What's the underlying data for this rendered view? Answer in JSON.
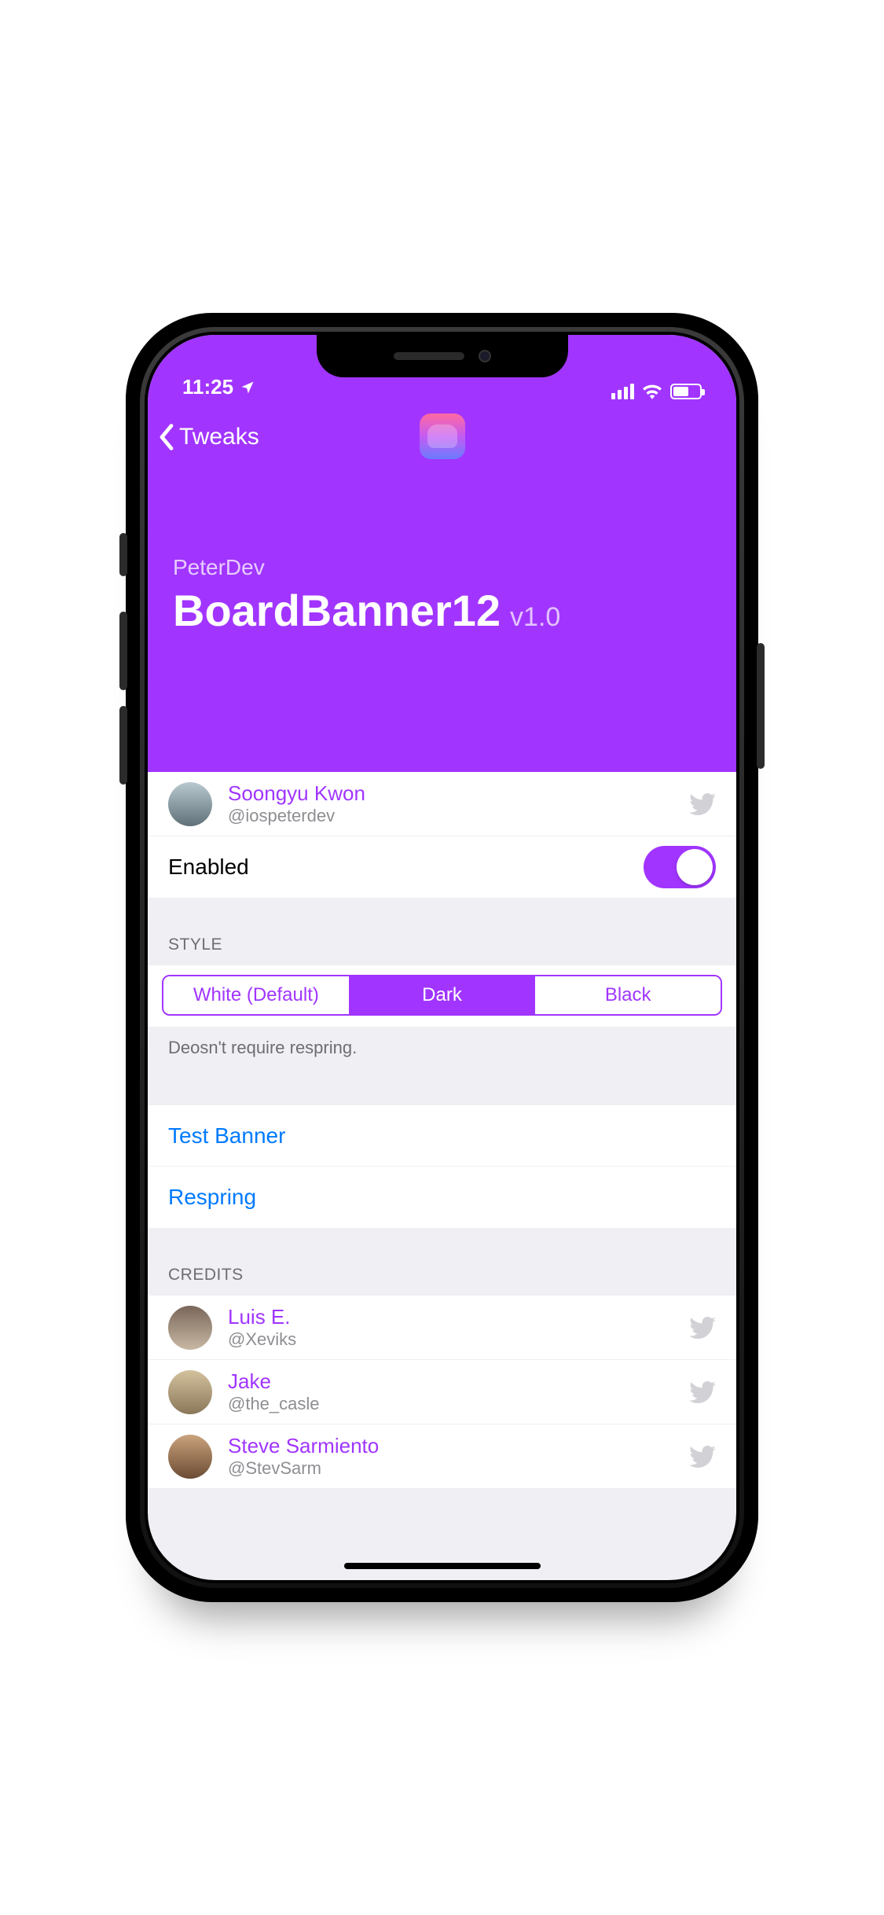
{
  "status": {
    "time": "11:25"
  },
  "nav": {
    "back_label": "Tweaks"
  },
  "header": {
    "developer": "PeterDev",
    "title": "BoardBanner12",
    "version": "v1.0"
  },
  "author": {
    "name": "Soongyu Kwon",
    "handle": "@iospeterdev"
  },
  "enable": {
    "label": "Enabled",
    "value": true
  },
  "style": {
    "header": "Style",
    "options": [
      "White (Default)",
      "Dark",
      "Black"
    ],
    "selected_index": 1,
    "footer": "Deosn't require respring."
  },
  "actions": {
    "test_banner": "Test Banner",
    "respring": "Respring"
  },
  "credits": {
    "header": "Credits",
    "items": [
      {
        "name": "Luis E.",
        "handle": "@Xeviks"
      },
      {
        "name": "Jake",
        "handle": "@the_casle"
      },
      {
        "name": "Steve Sarmiento",
        "handle": "@StevSarm"
      }
    ]
  },
  "colors": {
    "accent": "#a135ff",
    "link": "#007aff"
  }
}
